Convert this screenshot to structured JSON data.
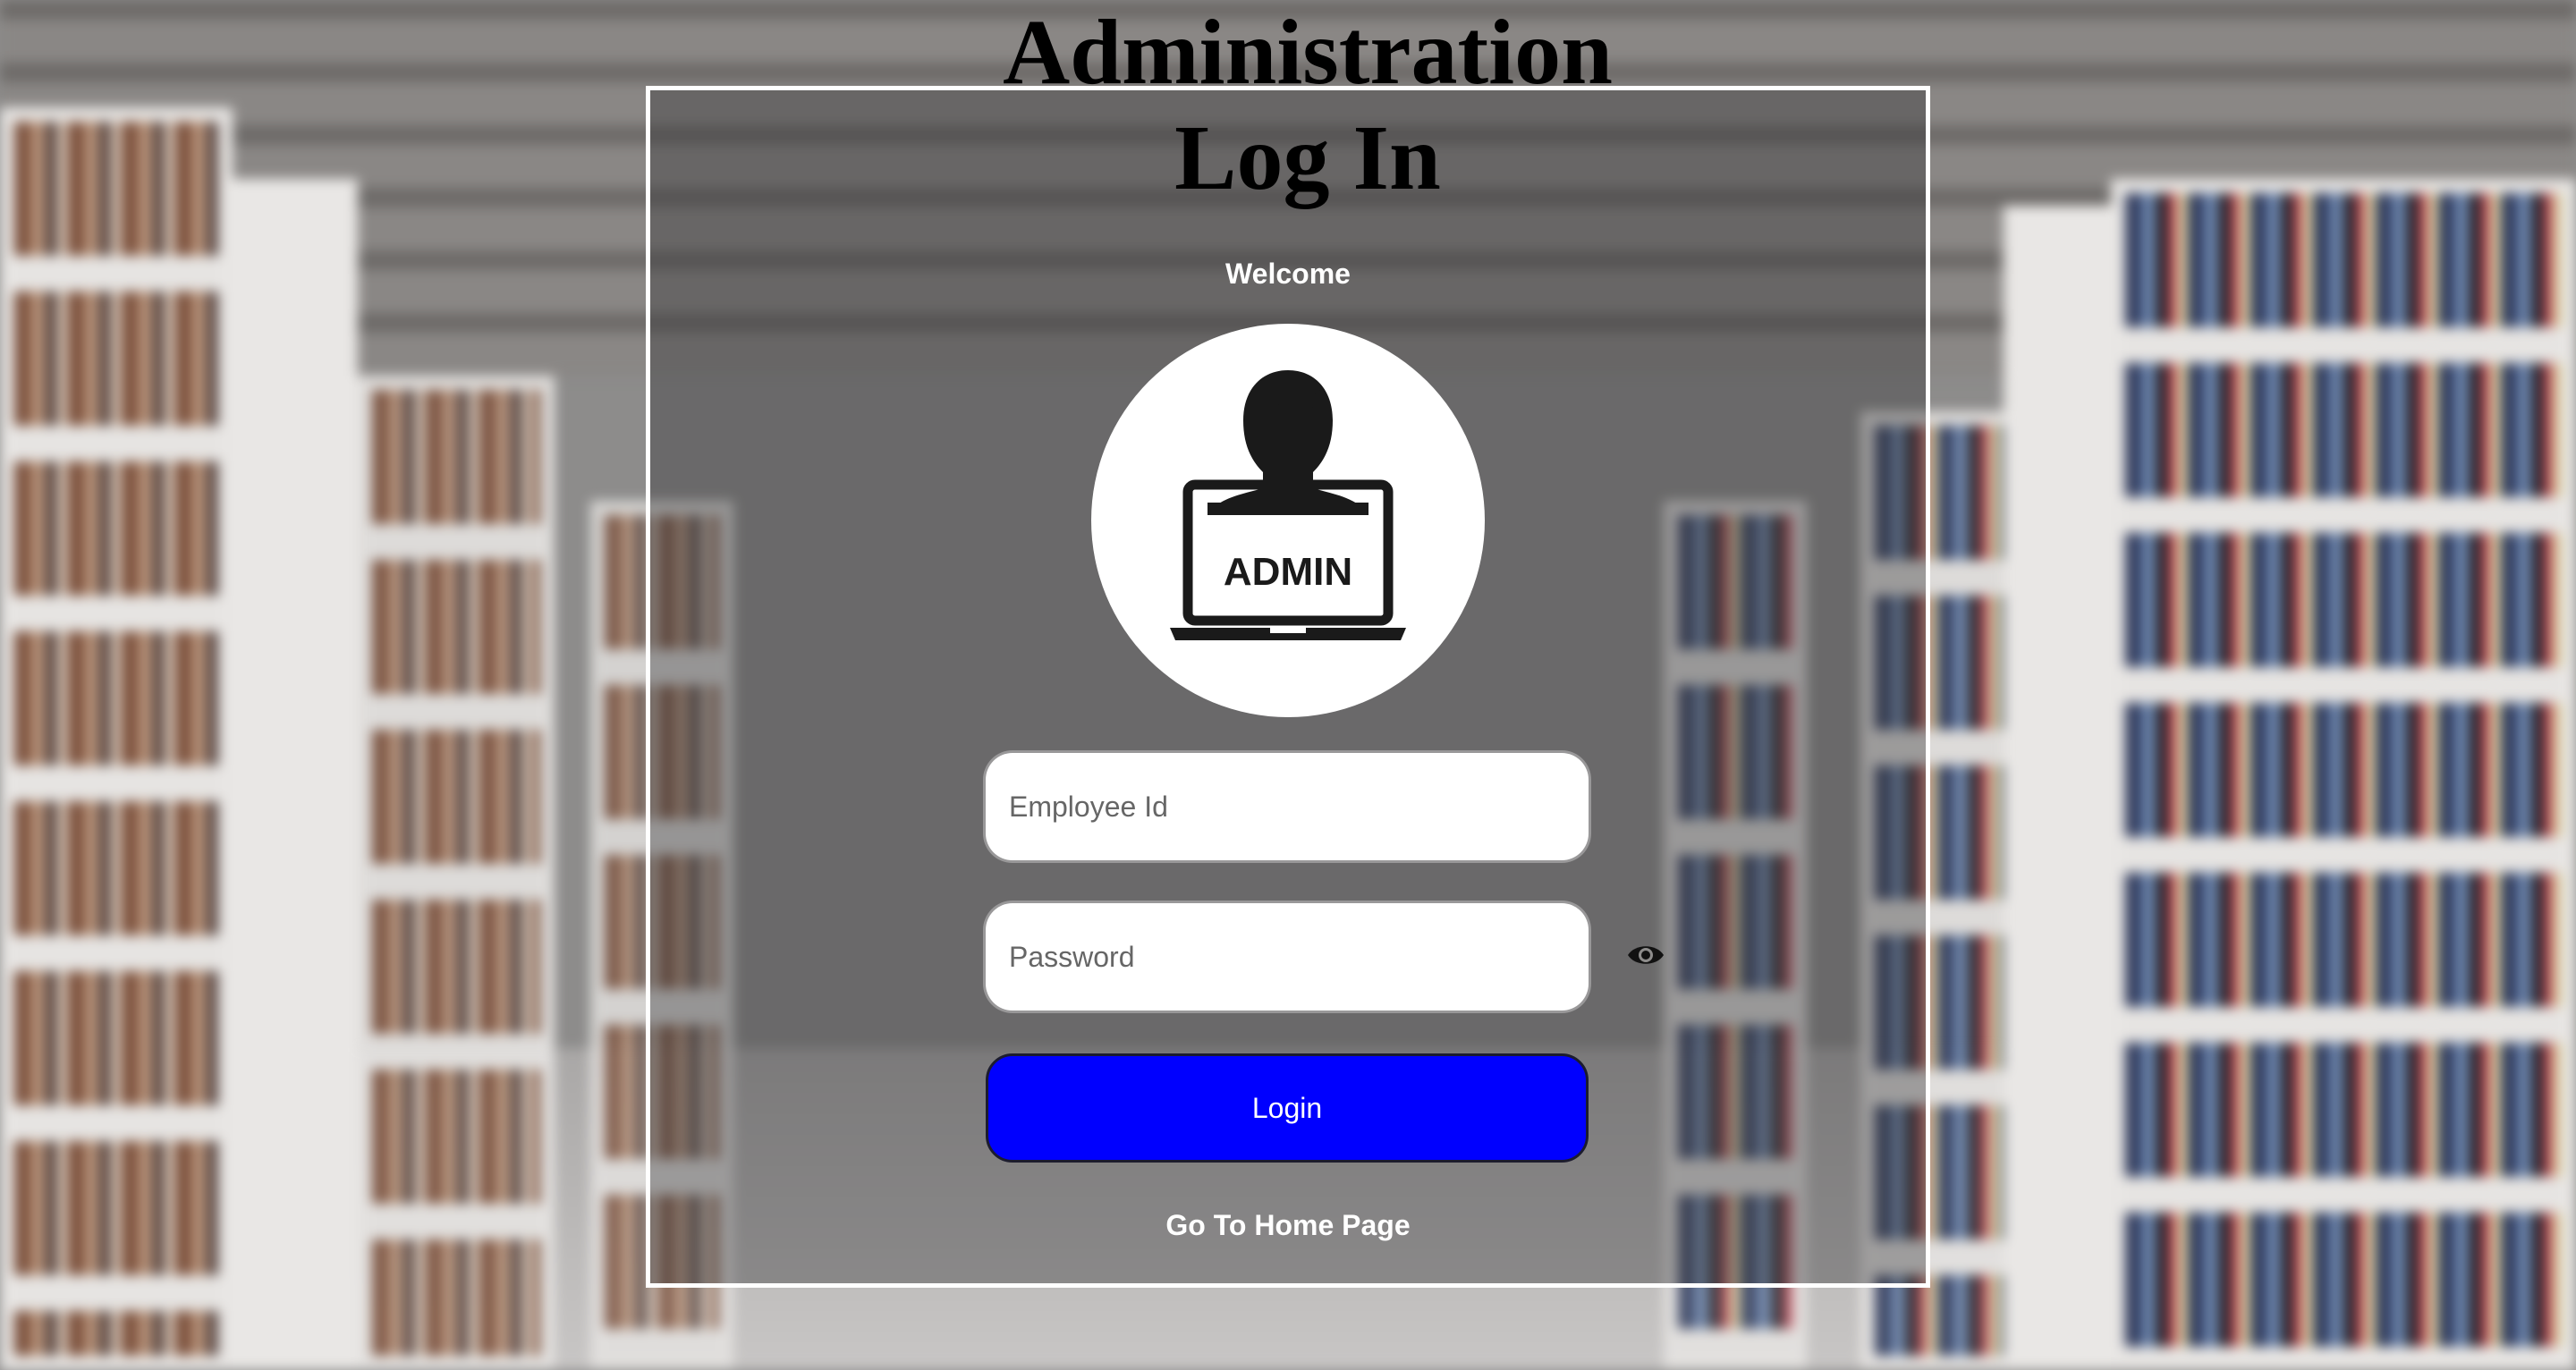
{
  "title": {
    "line1": "Administration",
    "line2": "Log In"
  },
  "welcome": "Welcome",
  "avatar": {
    "icon": "admin-laptop-icon",
    "label": "ADMIN"
  },
  "form": {
    "employee_id_placeholder": "Employee Id",
    "employee_id_value": "",
    "password_placeholder": "Password",
    "password_value": "",
    "toggle_icon": "eye-icon",
    "login_label": "Login"
  },
  "home_link": "Go To Home Page",
  "colors": {
    "login_button": "#0000ff",
    "frame_border": "#ffffff",
    "text_light": "#ffffff"
  }
}
